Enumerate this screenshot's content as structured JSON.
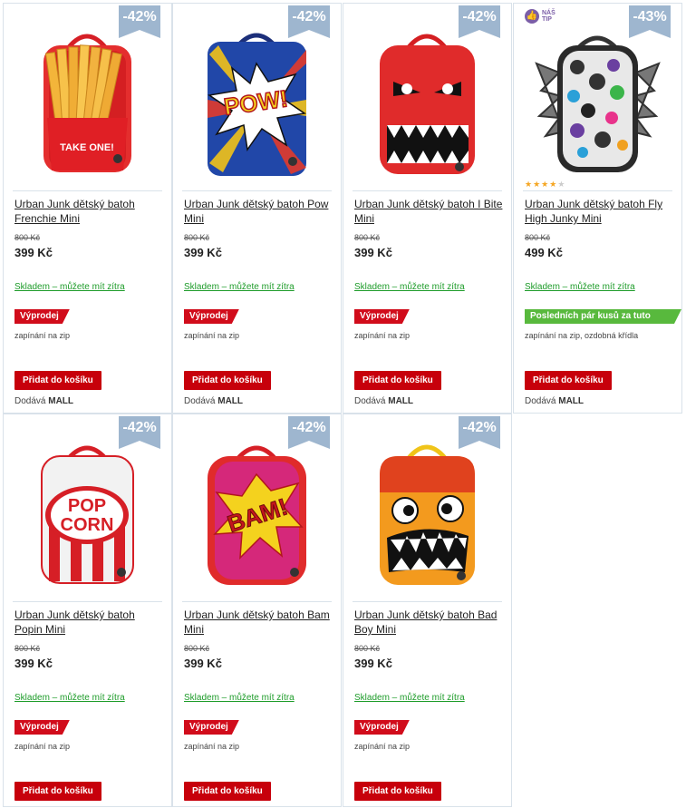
{
  "products": [
    {
      "title": "Urban Junk dětský batoh Frenchie Mini",
      "discount": "-42%",
      "old_price": "800 Kč",
      "price": "399 Kč",
      "stock": "Skladem – můžete mít zítra",
      "flag": "Výprodej",
      "variant": "zapínání na zip",
      "cta": "Přidat do košíku",
      "seller_prefix": "Dodává",
      "seller": "MALL",
      "image": "fries-backpack"
    },
    {
      "title": "Urban Junk dětský batoh Pow Mini",
      "discount": "-42%",
      "old_price": "800 Kč",
      "price": "399 Kč",
      "stock": "Skladem – můžete mít zítra",
      "flag": "Výprodej",
      "variant": "zapínání na zip",
      "cta": "Přidat do košíku",
      "seller_prefix": "Dodává",
      "seller": "MALL",
      "image": "pow-backpack"
    },
    {
      "title": "Urban Junk dětský batoh I Bite Mini",
      "discount": "-42%",
      "old_price": "800 Kč",
      "price": "399 Kč",
      "stock": "Skladem – můžete mít zítra",
      "flag": "Výprodej",
      "variant": "zapínání na zip",
      "cta": "Přidat do košíku",
      "seller_prefix": "Dodává",
      "seller": "MALL",
      "image": "ibite-backpack"
    },
    {
      "title": "Urban Junk dětský batoh Fly High Junky Mini",
      "discount": "-43%",
      "old_price": "800 Kč",
      "price": "499 Kč",
      "stock": "Skladem – můžete mít zítra",
      "flag": "Posledních pár kusů za tuto cenu!",
      "variant": "zapínání na zip, ozdobná křídla",
      "cta": "Přidat do košíku",
      "seller_prefix": "Dodává",
      "seller": "MALL",
      "image": "flyhigh-backpack",
      "tip_line1": "NÁŠ",
      "tip_line2": "TIP",
      "rating": 4
    },
    {
      "title": "Urban Junk dětský batoh Popin Mini",
      "discount": "-42%",
      "old_price": "800 Kč",
      "price": "399 Kč",
      "stock": "Skladem – můžete mít zítra",
      "flag": "Výprodej",
      "variant": "zapínání na zip",
      "cta": "Přidat do košíku",
      "image": "popcorn-backpack"
    },
    {
      "title": "Urban Junk dětský batoh Bam Mini",
      "discount": "-42%",
      "old_price": "800 Kč",
      "price": "399 Kč",
      "stock": "Skladem – můžete mít zítra",
      "flag": "Výprodej",
      "variant": "zapínání na zip",
      "cta": "Přidat do košíku",
      "image": "bam-backpack"
    },
    {
      "title": "Urban Junk dětský batoh Bad Boy Mini",
      "discount": "-42%",
      "old_price": "800 Kč",
      "price": "399 Kč",
      "stock": "Skladem – můžete mít zítra",
      "flag": "Výprodej",
      "variant": "zapínání na zip",
      "cta": "Přidat do košíku",
      "image": "badboy-backpack"
    }
  ],
  "image_text": {
    "fries": "TAKE ONE!",
    "pow": "POW!",
    "popcorn_1": "POP",
    "popcorn_2": "CORN",
    "bam": "BAM!"
  },
  "colors": {
    "discount_badge": "#9eb6cf",
    "cta_red": "#c7000b",
    "sale_flag": "#d10c1b",
    "last_pieces_flag": "#58b93d",
    "stock_green": "#1e9c2a",
    "tip_purple": "#7b5ea7",
    "star": "#f5a623"
  }
}
